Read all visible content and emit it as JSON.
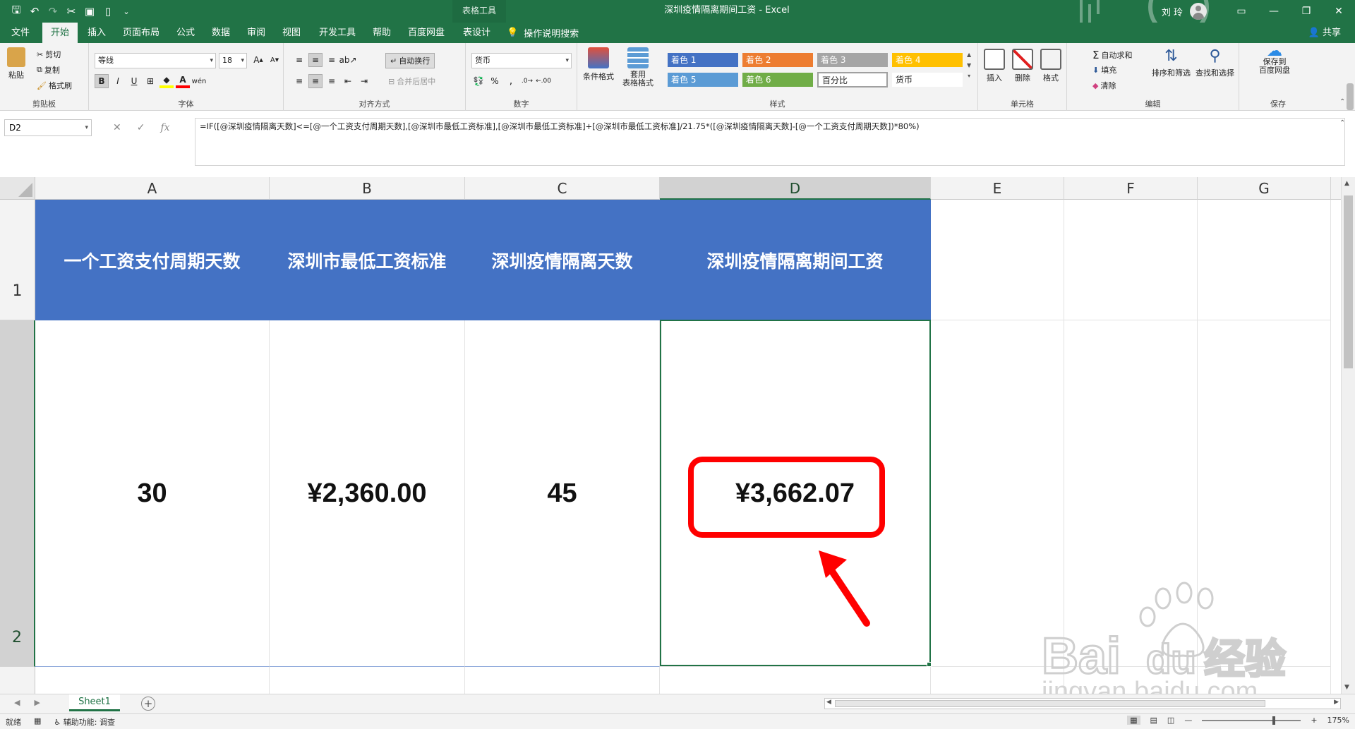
{
  "titlebar": {
    "qat_icons": [
      "save-icon",
      "undo-icon",
      "redo-icon",
      "cut-icon",
      "save-as-icon",
      "new-icon",
      "customize-icon"
    ],
    "context_tools": "表格工具",
    "window_title": "深圳疫情隔离期间工资  -  Excel",
    "user_name": "刘 玲"
  },
  "tabs": [
    "文件",
    "开始",
    "插入",
    "页面布局",
    "公式",
    "数据",
    "审阅",
    "视图",
    "开发工具",
    "帮助",
    "百度网盘",
    "表设计"
  ],
  "active_tab": "开始",
  "tell_me": "操作说明搜索",
  "share": "共享",
  "ribbon": {
    "clipboard": {
      "paste": "粘贴",
      "cut": "剪切",
      "copy": "复制",
      "painter": "格式刷",
      "label": "剪贴板"
    },
    "font": {
      "name": "等线",
      "size": "18",
      "label": "字体"
    },
    "align": {
      "wrap": "自动换行",
      "merge": "合并后居中",
      "label": "对齐方式"
    },
    "number": {
      "format": "货币",
      "label": "数字"
    },
    "styles": {
      "cond": "条件格式",
      "table": "套用\n表格格式",
      "label": "样式",
      "cells": [
        {
          "text": "着色 1",
          "bg": "#4472c4",
          "fg": "#ffffff"
        },
        {
          "text": "着色 2",
          "bg": "#ed7d31",
          "fg": "#ffffff"
        },
        {
          "text": "着色 3",
          "bg": "#a5a5a5",
          "fg": "#ffffff"
        },
        {
          "text": "着色 4",
          "bg": "#ffc000",
          "fg": "#ffffff"
        },
        {
          "text": "着色 5",
          "bg": "#5b9bd5",
          "fg": "#ffffff"
        },
        {
          "text": "着色 6",
          "bg": "#70ad47",
          "fg": "#ffffff"
        },
        {
          "text": "百分比",
          "bg": "#ffffff",
          "fg": "#222222"
        },
        {
          "text": "货币",
          "bg": "#ffffff",
          "fg": "#222222"
        }
      ]
    },
    "cells": {
      "insert": "插入",
      "delete": "删除",
      "format": "格式",
      "label": "单元格"
    },
    "editing": {
      "autosum": "自动求和",
      "fill": "填充",
      "clear": "清除",
      "sort": "排序和筛选",
      "find": "查找和选择",
      "label": "编辑"
    },
    "save": {
      "btn": "保存到\n百度网盘",
      "label": "保存"
    }
  },
  "formula_bar": {
    "name_box": "D2",
    "formula": "=IF([@深圳疫情隔离天数]<=[@一个工资支付周期天数],[@深圳市最低工资标准],[@深圳市最低工资标准]+[@深圳市最低工资标准]/21.75*([@深圳疫情隔离天数]-[@一个工资支付周期天数])*80%)"
  },
  "columns": [
    "A",
    "B",
    "C",
    "D",
    "E",
    "F",
    "G"
  ],
  "selected_column": "D",
  "rows": [
    "1",
    "2"
  ],
  "selected_row": "2",
  "table": {
    "headers": [
      "一个工资支付周期天数",
      "深圳市最低工资标准",
      "深圳疫情隔离天数",
      "深圳疫情隔离期间工资"
    ],
    "row": [
      "30",
      "¥2,360.00",
      "45",
      "¥3,662.07"
    ],
    "header_color": "#4472c4"
  },
  "sheets": [
    "Sheet1"
  ],
  "status": {
    "ready": "就绪",
    "accessibility": "辅助功能: 调查",
    "zoom": "175%"
  },
  "accent_color": "#217346",
  "watermark": {
    "brand": "Bai",
    "brand_tail": "du",
    "cn": "经验",
    "url": "jingyan.baidu.com"
  }
}
